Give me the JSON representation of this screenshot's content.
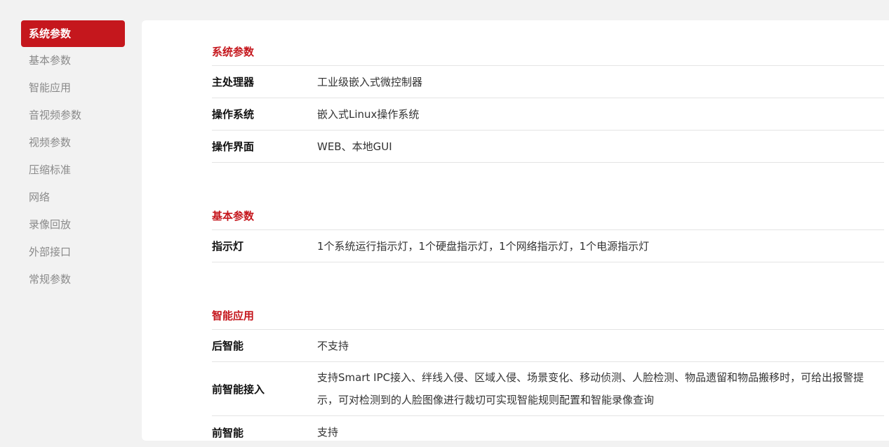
{
  "sidebar": {
    "items": [
      {
        "label": "系统参数",
        "active": true
      },
      {
        "label": "基本参数",
        "active": false
      },
      {
        "label": "智能应用",
        "active": false
      },
      {
        "label": "音视频参数",
        "active": false
      },
      {
        "label": "视频参数",
        "active": false
      },
      {
        "label": "压缩标准",
        "active": false
      },
      {
        "label": "网络",
        "active": false
      },
      {
        "label": "录像回放",
        "active": false
      },
      {
        "label": "外部接口",
        "active": false
      },
      {
        "label": "常规参数",
        "active": false
      }
    ]
  },
  "sections": {
    "system": {
      "title": "系统参数",
      "rows": [
        {
          "label": "主处理器",
          "value": "工业级嵌入式微控制器"
        },
        {
          "label": "操作系统",
          "value": "嵌入式Linux操作系统"
        },
        {
          "label": "操作界面",
          "value": "WEB、本地GUI"
        }
      ]
    },
    "basic": {
      "title": "基本参数",
      "rows": [
        {
          "label": "指示灯",
          "value": "1个系统运行指示灯，1个硬盘指示灯，1个网络指示灯，1个电源指示灯"
        }
      ]
    },
    "smart": {
      "title": "智能应用",
      "rows": [
        {
          "label": "后智能",
          "value": "不支持"
        },
        {
          "label": "前智能接入",
          "value": "支持Smart IPC接入、绊线入侵、区域入侵、场景变化、移动侦测、人脸检测、物品遗留和物品搬移时，可给出报警提示，可对检测到的人脸图像进行裁切可实现智能规则配置和智能录像查询"
        },
        {
          "label": "前智能",
          "value": "支持"
        }
      ]
    }
  },
  "colors": {
    "accent": "#c5171d",
    "background": "#f2f2f2",
    "panel": "#ffffff"
  }
}
